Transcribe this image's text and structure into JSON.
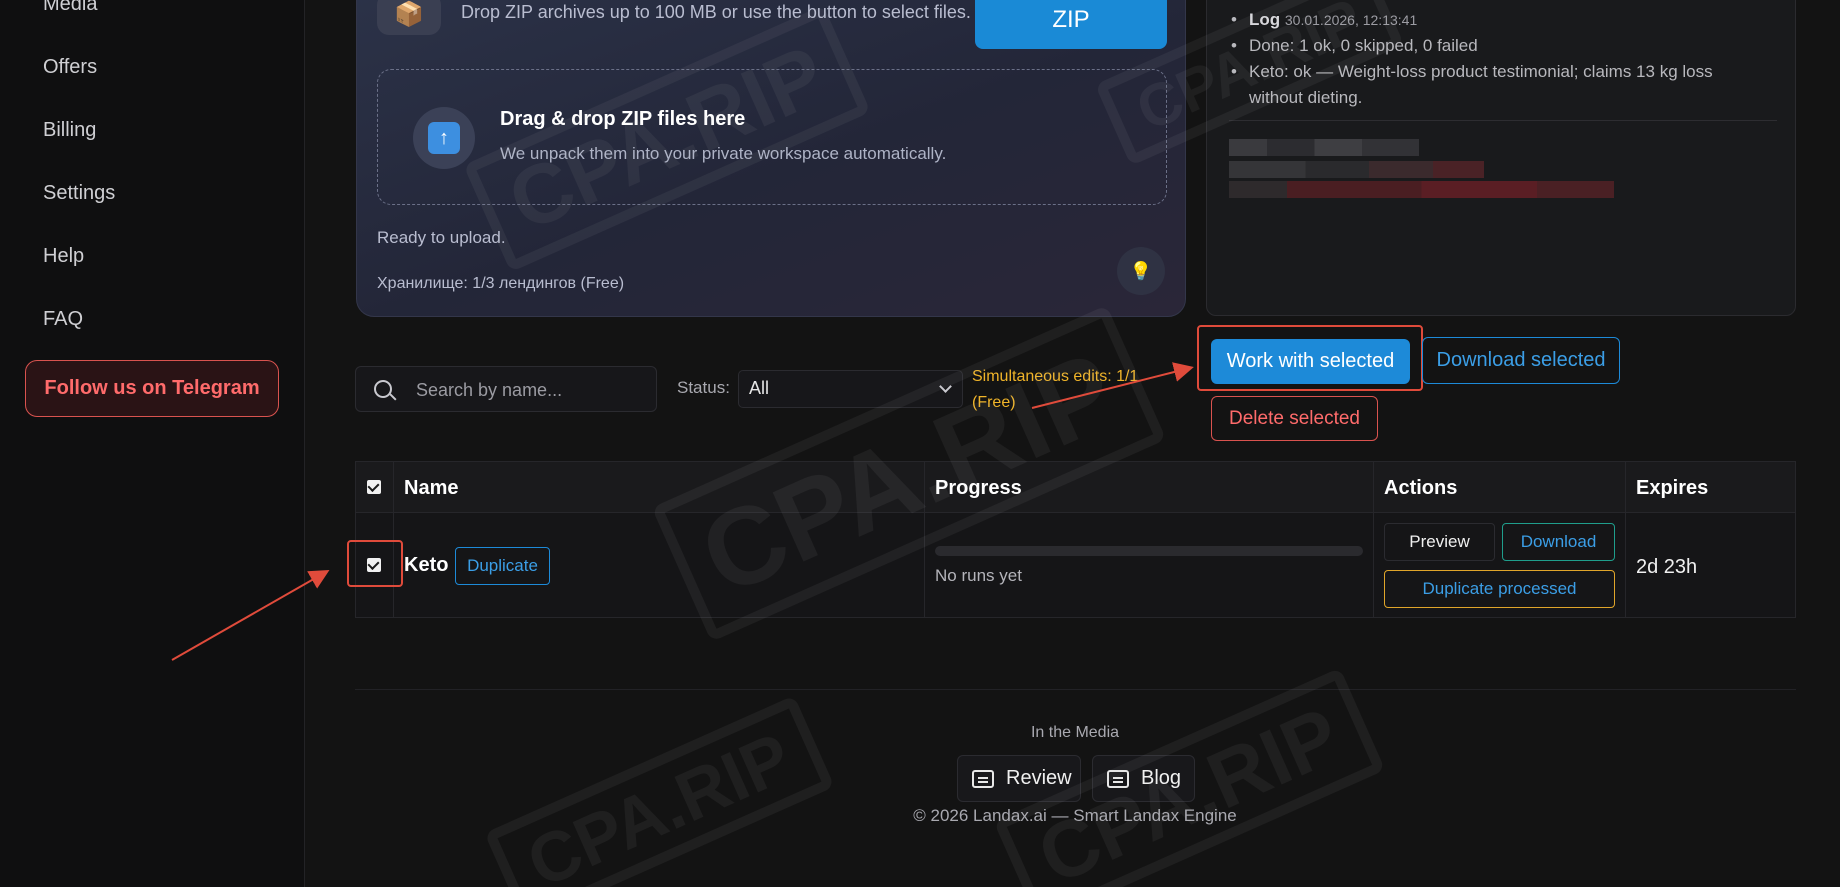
{
  "sidebar": {
    "items": [
      {
        "label": "Media"
      },
      {
        "label": "Offers"
      },
      {
        "label": "Billing"
      },
      {
        "label": "Settings"
      },
      {
        "label": "Help"
      },
      {
        "label": "FAQ"
      }
    ],
    "telegram_label": "Follow us on Telegram"
  },
  "upload": {
    "description": "Drop ZIP archives up to 100 MB or use the button to select files.",
    "zip_button": "ZIP",
    "dropzone_title": "Drag & drop ZIP files here",
    "dropzone_subtitle": "We unpack them into your private workspace automatically.",
    "status": "Ready to upload.",
    "storage": "Хранилище: 1/3 лендингов (Free)"
  },
  "log": {
    "title": "Log",
    "timestamp": "30.01.2026, 12:13:41",
    "entries": [
      "Done: 1 ok, 0 skipped, 0 failed",
      "Keto: ok — Weight-loss product testimonial; claims 13 kg loss without dieting."
    ]
  },
  "filters": {
    "search_placeholder": "Search by name...",
    "status_label": "Status:",
    "status_value": "All",
    "simultaneous_note": "Simultaneous edits: 1/1 (Free)"
  },
  "bulk": {
    "work_label": "Work with selected",
    "download_label": "Download selected",
    "delete_label": "Delete selected"
  },
  "table": {
    "columns": [
      "Name",
      "Progress",
      "Actions",
      "Expires"
    ],
    "rows": [
      {
        "name": "Keto",
        "duplicate_label": "Duplicate",
        "progress_fraction": 0,
        "progress_text": "No runs yet",
        "preview_label": "Preview",
        "download_label": "Download",
        "duplicate_processed_label": "Duplicate processed",
        "expires": "2d 23h"
      }
    ]
  },
  "footer": {
    "media_label": "In the Media",
    "review_label": "Review",
    "blog_label": "Blog",
    "copyright": "© 2026 Landax.ai — Smart Landax Engine"
  },
  "watermark": "CPA.RIP",
  "colors": {
    "accent": "#1d8ad8",
    "danger": "#d9534f",
    "warning": "#f0b429",
    "highlight": "#e04b3b"
  }
}
